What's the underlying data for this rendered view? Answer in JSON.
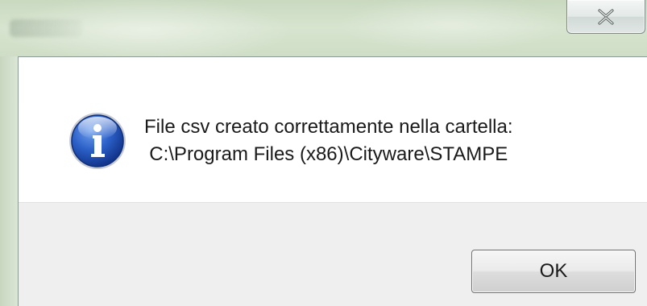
{
  "window": {
    "close_label": "",
    "close_icon": "close-icon"
  },
  "dialog": {
    "icon": "info-icon",
    "message_line1": "File csv creato correttamente nella cartella:",
    "message_line2": "C:\\Program Files (x86)\\Cityware\\STAMPE"
  },
  "buttons": {
    "ok_label": "OK"
  },
  "colors": {
    "icon_blue": "#1f4fb5",
    "footer_bg": "#efefef",
    "content_bg": "#ffffff"
  }
}
